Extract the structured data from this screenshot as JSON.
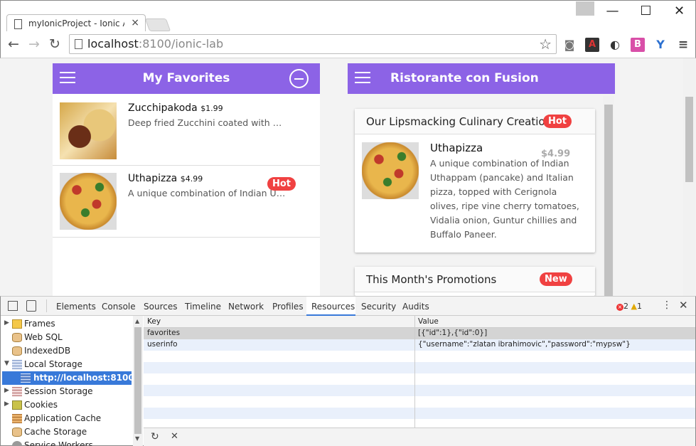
{
  "browser": {
    "tab_title": "myIonicProject - Ionic App",
    "url_host": "localhost",
    "url_path": ":8100/ionic-lab",
    "window_controls": [
      "—",
      "☐",
      "✕"
    ],
    "nav": {
      "back": "←",
      "forward": "→",
      "reload": "↻"
    },
    "extensions": [
      "camera-icon",
      "pdf-icon",
      "moon-icon",
      "b-icon",
      "y-icon",
      "menu-icon"
    ]
  },
  "left_app": {
    "title": "My Favorites",
    "items": [
      {
        "name": "Zucchipakoda",
        "price": "$1.99",
        "desc": "Deep fried Zucchini coated with mildly spiced Chickpea flour batter",
        "badge": ""
      },
      {
        "name": "Uthapizza",
        "price": "$4.99",
        "desc": "A unique combination of Indian Uthappam",
        "badge": "Hot"
      }
    ]
  },
  "right_app": {
    "title": "Ristorante con Fusion",
    "card1": {
      "header": "Our Lipsmacking Culinary Creation",
      "badge": "Hot",
      "dish": "Uthapizza",
      "price": "$4.99",
      "desc_lines": [
        "A unique combination of Indian",
        "Uthappam (pancake) and Italian",
        "pizza, topped with Cerignola",
        "olives, ripe vine cherry tomatoes,",
        "Vidalia onion, Guntur chillies and",
        "Buffalo Paneer."
      ]
    },
    "card2": {
      "header": "This Month's Promotions",
      "badge": "New"
    }
  },
  "devtools": {
    "tabs": [
      "Elements",
      "Console",
      "Sources",
      "Timeline",
      "Network",
      "Profiles",
      "Resources",
      "Security",
      "Audits"
    ],
    "selected_tab": "Resources",
    "errors": "2",
    "warnings": "1",
    "tree": [
      {
        "label": "Frames",
        "icon": "folder-icon",
        "arrow": "▶"
      },
      {
        "label": "Web SQL",
        "icon": "database-icon",
        "arrow": ""
      },
      {
        "label": "IndexedDB",
        "icon": "database-icon",
        "arrow": ""
      },
      {
        "label": "Local Storage",
        "icon": "grid-icon",
        "arrow": "▼"
      },
      {
        "label": "http://localhost:8100",
        "icon": "grid-icon",
        "arrow": ""
      },
      {
        "label": "Session Storage",
        "icon": "grid-icon",
        "arrow": "▶"
      },
      {
        "label": "Cookies",
        "icon": "cookie-icon",
        "arrow": "▶"
      },
      {
        "label": "Application Cache",
        "icon": "grid-icon",
        "arrow": ""
      },
      {
        "label": "Cache Storage",
        "icon": "database-icon",
        "arrow": ""
      },
      {
        "label": "Service Workers",
        "icon": "gear-icon",
        "arrow": ""
      }
    ],
    "columns": {
      "key": "Key",
      "value": "Value"
    },
    "rows": [
      {
        "key": "favorites",
        "value": "[{\"id\":1},{\"id\":0}]"
      },
      {
        "key": "userinfo",
        "value": "{\"username\":\"zlatan ibrahimovic\",\"password\":\"mypsw\"}"
      }
    ],
    "footer": {
      "refresh": "↻",
      "delete": "✕"
    }
  }
}
